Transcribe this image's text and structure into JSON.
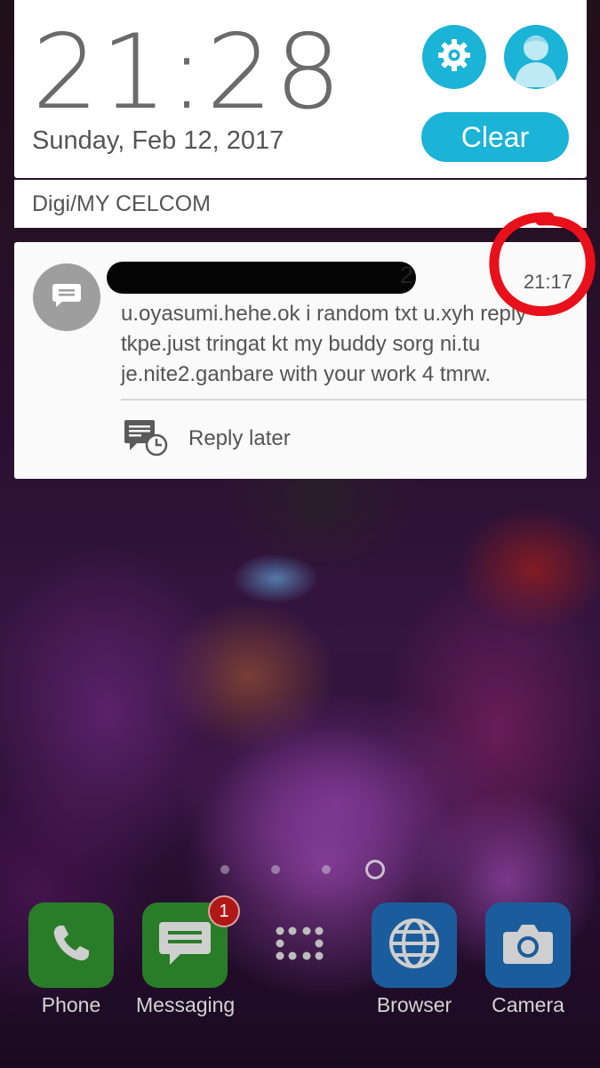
{
  "quick_panel": {
    "time": "21:28",
    "date": "Sunday, Feb 12, 2017",
    "clear_label": "Clear",
    "carrier": "Digi/MY CELCOM",
    "settings_icon": "gear-icon",
    "profile_icon": "user-avatar-icon",
    "accent_color": "#1bb3d6"
  },
  "notification": {
    "sender_visible_suffix": "2",
    "time": "21:17",
    "body": "u.oyasumi.hehe.ok i random txt u.xyh reply\ntkpe.just tringat kt my buddy sorg ni.tu\nje.nite2.ganbare with your work 4 tmrw.",
    "action_label": "Reply later",
    "icon": "message-icon"
  },
  "home": {
    "page_count": 4,
    "current_page": "home",
    "dock": [
      {
        "label": "Phone",
        "icon": "phone-icon",
        "color": "#2f9c2f"
      },
      {
        "label": "Messaging",
        "icon": "message-icon",
        "color": "#2f9c2f",
        "badge": "1"
      },
      {
        "label": "",
        "icon": "app-drawer-icon"
      },
      {
        "label": "Browser",
        "icon": "globe-icon",
        "color": "#1c6fb8"
      },
      {
        "label": "Camera",
        "icon": "camera-icon",
        "color": "#1c6fb8"
      }
    ]
  }
}
